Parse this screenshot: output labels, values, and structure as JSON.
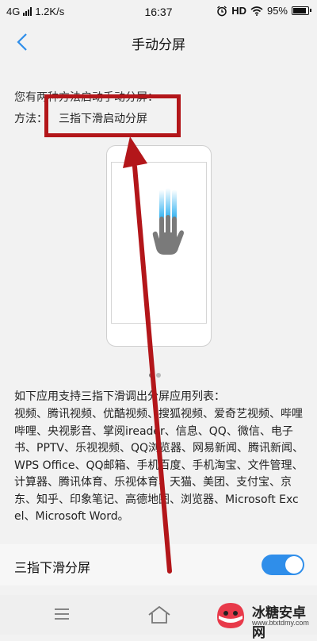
{
  "status_bar": {
    "network": "4G",
    "speed": "1.2K/s",
    "time": "16:37",
    "hd": "HD",
    "battery_percent": "95%",
    "battery_level": 0.95,
    "icons": [
      "signal-icon",
      "alarm-icon",
      "wifi-icon",
      "battery-icon"
    ]
  },
  "nav": {
    "back_icon": "back-chevron-icon",
    "title": "手动分屏"
  },
  "guide": {
    "intro": "您有两种方法启动手动分屏：",
    "method_label": "方法：",
    "method_value": "三指下滑启动分屏",
    "illustration": "three-finger-swipe-down-icon",
    "page_count": 2,
    "active_page": 1
  },
  "apps": {
    "heading": "如下应用支持三指下滑调出分屏应用列表：",
    "list": "视频、腾讯视频、优酷视频、搜狐视频、爱奇艺视频、哔哩哔哩、央视影音、掌阅ireader、信息、QQ、微信、电子书、PPTV、乐视视频、QQ浏览器、网易新闻、腾讯新闻、WPS Office、QQ邮箱、手机百度、手机淘宝、文件管理、计算器、腾讯体育、乐视体育、天猫、美团、支付宝、京东、知乎、印象笔记、高德地图、浏览器、Microsoft Excel、Microsoft Word。"
  },
  "setting": {
    "label": "三指下滑分屏",
    "enabled": true,
    "accent_color": "#2f8eea"
  },
  "bottom_nav": {
    "icons": [
      "menu-icon",
      "home-icon"
    ]
  },
  "watermark": {
    "title": "冰糖安卓网",
    "url": "www.btxtdmy.com"
  },
  "annotation": {
    "color": "#b3161a"
  }
}
